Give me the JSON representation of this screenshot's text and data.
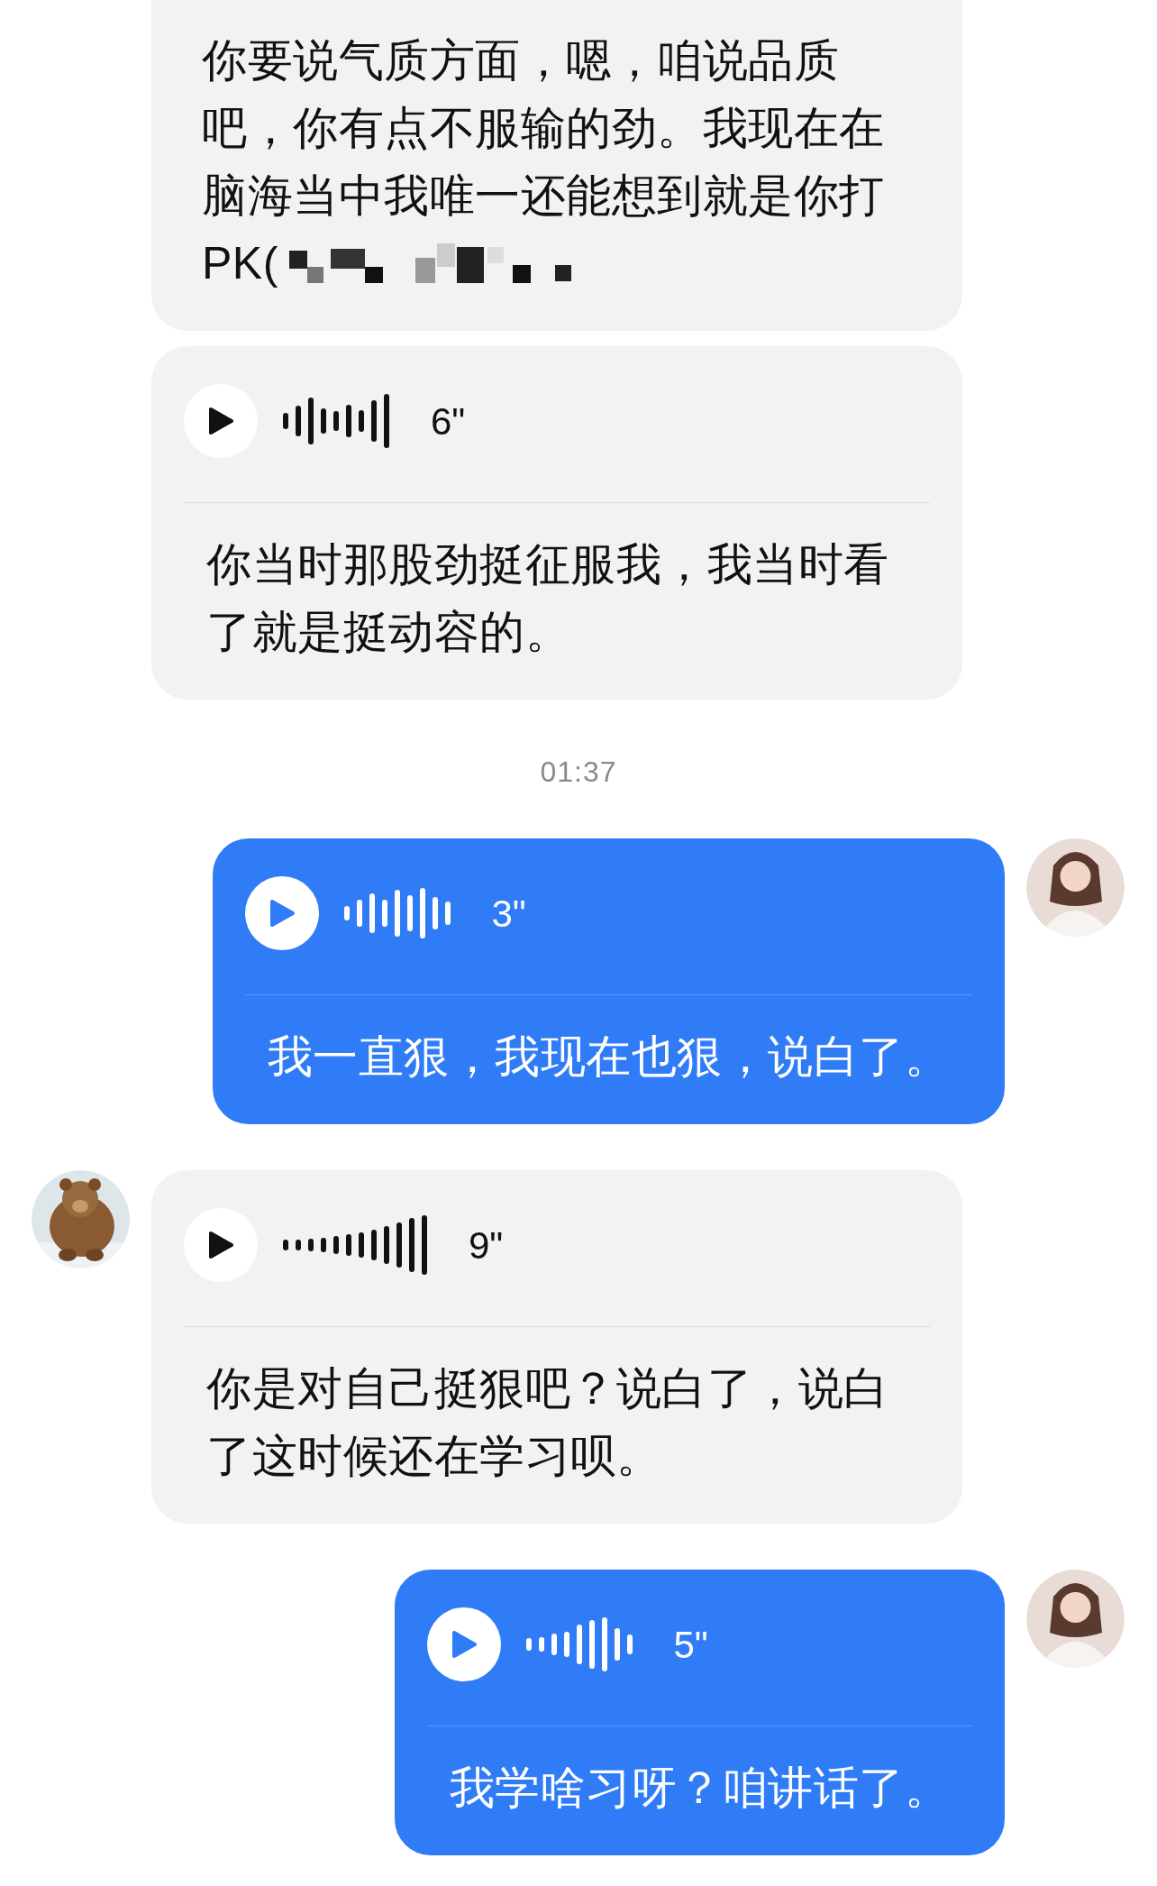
{
  "messages": [
    {
      "outgoing": false,
      "kind": "text",
      "text": "你要说气质方面，嗯，咱说品质吧，你有点不服输的劲。我现在在脑海当中我唯一还能想到就是你打",
      "tail": "PK(",
      "redacted": true
    },
    {
      "outgoing": false,
      "kind": "voice",
      "duration": "6\"",
      "transcript": "你当时那股劲挺征服我，我当时看了就是挺动容的。"
    },
    {
      "kind": "time",
      "text": "01:37"
    },
    {
      "outgoing": true,
      "kind": "voice",
      "duration": "3\"",
      "transcript": "我一直狠，我现在也狠，说白了。",
      "avatar": {
        "kind": "silhouette"
      }
    },
    {
      "outgoing": false,
      "kind": "voice",
      "duration": "9\"",
      "transcript": "你是对自己挺狠吧？说白了，说白了这时候还在学习呗。"
    },
    {
      "outgoing": true,
      "kind": "voice",
      "duration": "5\"",
      "transcript": "我学啥习呀？咱讲话了。",
      "avatar": {
        "kind": "silhouette"
      }
    }
  ]
}
